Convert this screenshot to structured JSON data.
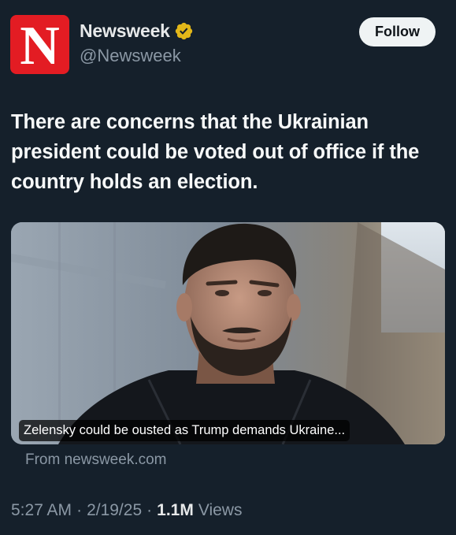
{
  "account": {
    "logo_letter": "N",
    "name": "Newsweek",
    "handle": "@Newsweek",
    "verified_icon": "gold-verified-badge",
    "follow_label": "Follow"
  },
  "tweet": {
    "text": "There are concerns that the Ukrainian president could be voted out of office if the country holds an election."
  },
  "card": {
    "caption": "Zelensky could be ousted as Trump demands Ukraine...",
    "source": "From newsweek.com"
  },
  "meta": {
    "time": "5:27 AM",
    "separator": "·",
    "date": "2/19/25",
    "views_count": "1.1M",
    "views_label": "Views"
  },
  "colors": {
    "background": "#15202b",
    "logo_red": "#e31c23",
    "verified_gold": "#e2b719",
    "muted_text": "#8b98a5"
  }
}
